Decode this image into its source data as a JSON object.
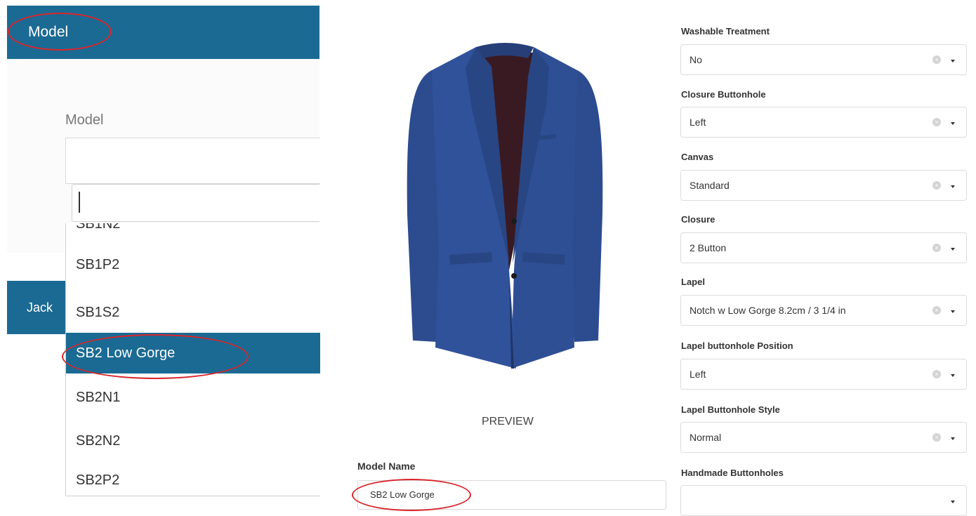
{
  "left": {
    "header_title": "Model",
    "field_label": "Model",
    "search_value": "",
    "options": [
      {
        "label": "SB1N2",
        "selected": false
      },
      {
        "label": "SB1P2",
        "selected": false
      },
      {
        "label": "SB1S2",
        "selected": false
      },
      {
        "label": "SB2 Low Gorge",
        "selected": true
      },
      {
        "label": "SB2N1",
        "selected": false
      },
      {
        "label": "SB2N2",
        "selected": false
      },
      {
        "label": "SB2P2",
        "selected": false
      }
    ],
    "jacket_header": "Jack"
  },
  "preview": {
    "caption": "PREVIEW",
    "model_name_label": "Model Name",
    "model_name_value": "SB2 Low Gorge"
  },
  "form": {
    "fields": [
      {
        "label": "Washable Treatment",
        "value": "No"
      },
      {
        "label": "Closure Buttonhole",
        "value": "Left"
      },
      {
        "label": "Canvas",
        "value": "Standard"
      },
      {
        "label": "Closure",
        "value": "2 Button"
      },
      {
        "label": "Lapel",
        "value": "Notch w Low Gorge 8.2cm / 3 1/4 in"
      },
      {
        "label": "Lapel buttonhole Position",
        "value": "Left"
      },
      {
        "label": "Lapel Buttonhole Style",
        "value": "Normal"
      },
      {
        "label": "Handmade Buttonholes",
        "value": ""
      }
    ]
  },
  "colors": {
    "header_blue": "#1b6a93",
    "jacket_blue": "#2f4f92",
    "highlight_red": "#d9262c"
  },
  "icons": [
    "clear-icon",
    "chevron-down-icon",
    "jacket-image"
  ]
}
